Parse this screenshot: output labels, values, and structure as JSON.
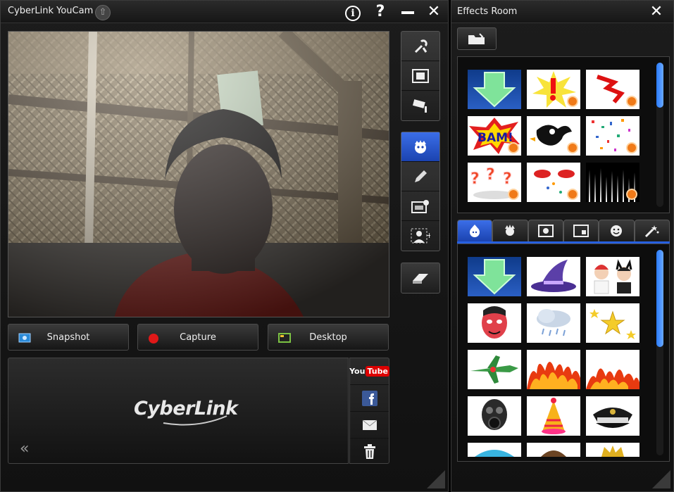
{
  "main": {
    "title": "CyberLink YouCam",
    "actions": [
      {
        "label": "Snapshot",
        "icon": "camera-icon",
        "color": "#2a8ad8"
      },
      {
        "label": "Capture",
        "icon": "record-icon",
        "color": "#e01818"
      },
      {
        "label": "Desktop",
        "icon": "desktop-icon",
        "color": "#7cc243"
      }
    ],
    "tray_logo": "CyberLink",
    "share": {
      "youtube_prefix": "You",
      "youtube_suffix": "Tube"
    }
  },
  "effects_room": {
    "title": "Effects Room",
    "tabs": [
      "face-icon",
      "particle-icon",
      "frame-icon",
      "filter-icon",
      "emotion-icon",
      "magic-icon"
    ]
  },
  "colors": {
    "accent": "#2760e0",
    "badge": "#f07a18"
  }
}
